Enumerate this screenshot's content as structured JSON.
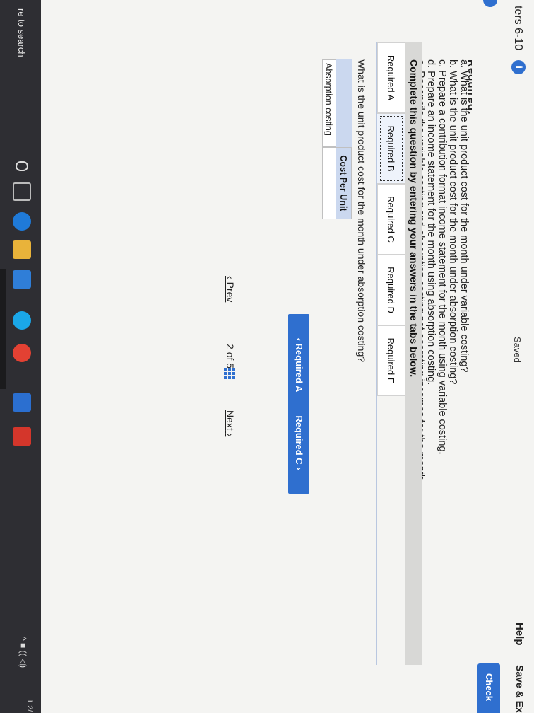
{
  "header": {
    "chapter": "ters 6-10",
    "info_badge": "i",
    "saved": "Saved",
    "help": "Help",
    "save_exit": "Save & Exi",
    "check": "Check"
  },
  "requirements": {
    "heading": "Required:",
    "items": [
      "a. What is the unit product cost for the month under variable costing?",
      "b. What is the unit product cost for the month under absorption costing?",
      "c. Prepare a contribution format income statement for the month using variable costing.",
      "d. Prepare an income statement for the month using absorption costing.",
      "e. Reconcile the variable costing and absorption costing net operating incomes for the month."
    ]
  },
  "instructions": "Complete this question by entering your answers in the tabs below.",
  "tabs": [
    "Required A",
    "Required B",
    "Required C",
    "Required D",
    "Required E"
  ],
  "active_tab": "Required B",
  "question": "What is the unit product cost for the month under absorption costing?",
  "table": {
    "header": "Cost Per Unit",
    "row_label": "Absorption costing",
    "value": ""
  },
  "nav": {
    "prev_label": "Required A",
    "next_label": "Required C"
  },
  "pager": {
    "prev": "Prev",
    "current": "2",
    "of": "of",
    "total": "5",
    "next": "Next"
  },
  "taskbar": {
    "search": "re to search",
    "tray": "^ ■ ((  ◁)",
    "clock": "1 2/"
  },
  "colors": {
    "accent": "#2f6fcf",
    "table_header": "#cbd8ef",
    "taskbar": "#2e2e33"
  }
}
